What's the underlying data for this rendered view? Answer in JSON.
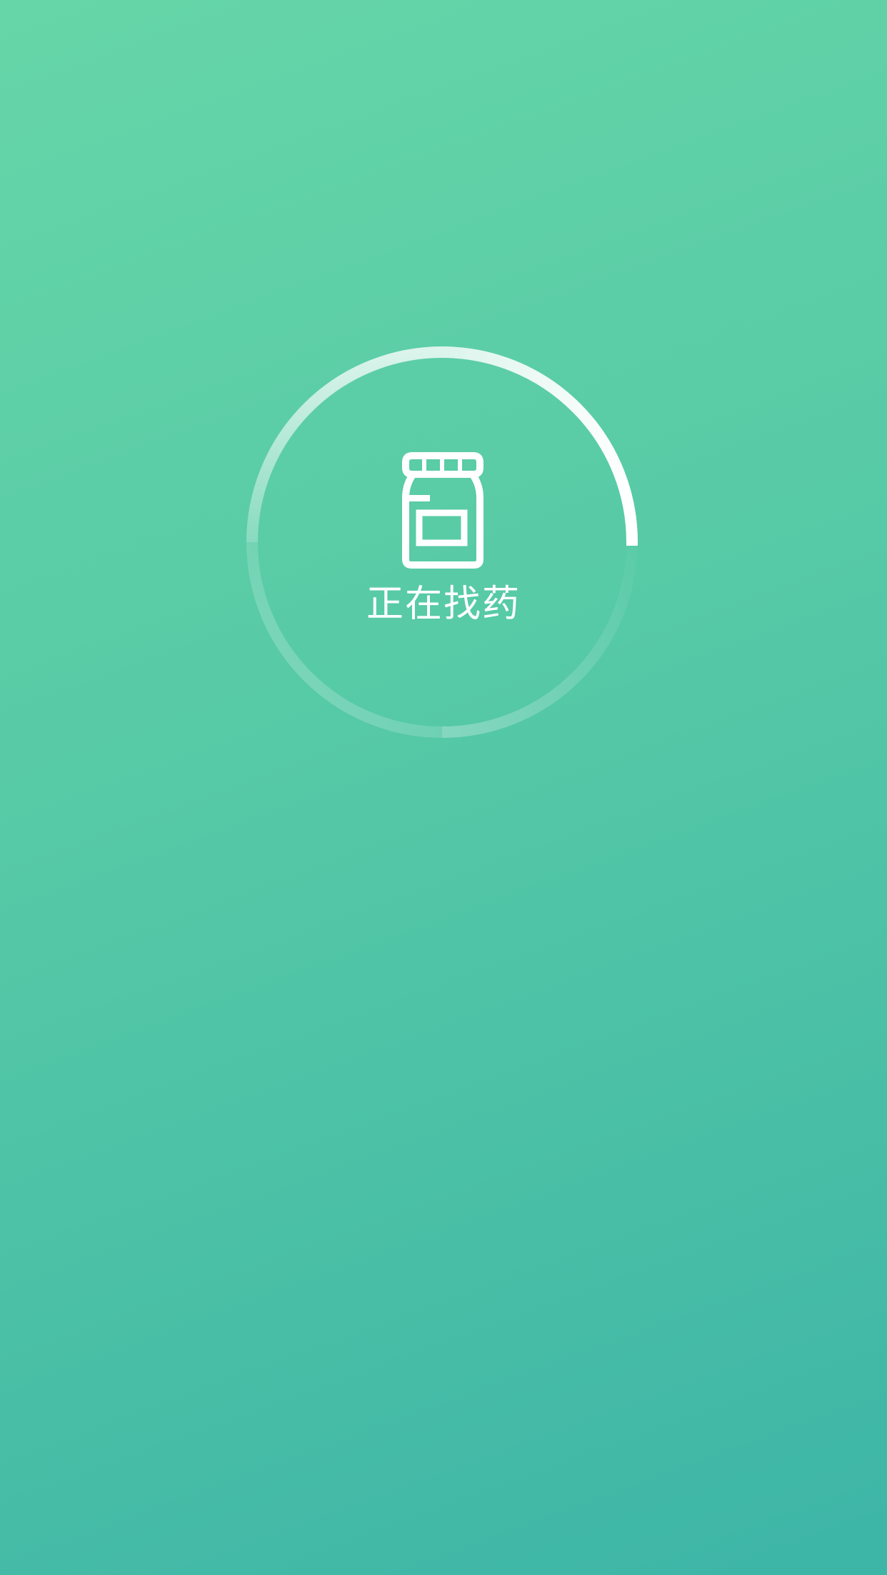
{
  "loading": {
    "text": "正在找药",
    "icon": "medicine-bottle-icon",
    "indicator": "circular-spinner"
  },
  "colors": {
    "gradient_start": "#66d6a8",
    "gradient_end": "#3db5a7",
    "foreground": "#ffffff"
  }
}
